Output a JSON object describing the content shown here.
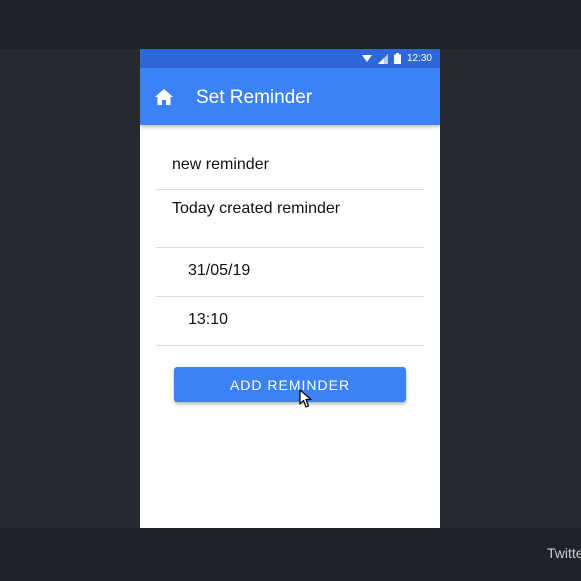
{
  "status_bar": {
    "time": "12:30"
  },
  "app_bar": {
    "title": "Set Reminder",
    "icon": "home-icon"
  },
  "form": {
    "title_value": "new reminder",
    "description_value": "Today created reminder",
    "date_value": "31/05/19",
    "time_value": "13:10"
  },
  "add_button": {
    "label": "ADD REMINDER"
  },
  "taskbar": {
    "text": "Twitte"
  },
  "colors": {
    "accent": "#3b82f6",
    "status_bar": "#2e67d6",
    "background": "#252a31"
  }
}
